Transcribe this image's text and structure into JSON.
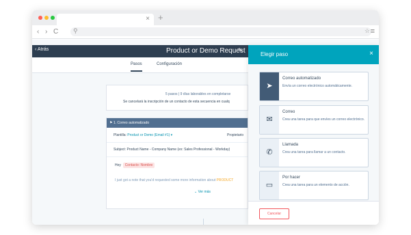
{
  "browser": {
    "tab_close": "×",
    "new_tab": "+",
    "nav_back": "‹",
    "nav_forward": "›",
    "nav_reload": "C",
    "search_glyph": "⚲",
    "star_glyph": "☆",
    "menu_glyph": "≡",
    "colors": {
      "red": "#ff5f57",
      "yellow": "#febc2e",
      "green": "#28c840"
    }
  },
  "header": {
    "back_label": "‹ Atrás",
    "title": "Product or Demo Request",
    "pencil_glyph": "✎"
  },
  "tabs": {
    "pasos": "Pasos",
    "configuracion": "Configuración"
  },
  "summary": {
    "line1": "5 pasos  |  9 días laborables en completarse",
    "line2": "Se cancelará la inscripción de un contacto de esta secuencia en cualq"
  },
  "step": {
    "header": "1. Correo automatizado",
    "flag_glyph": "⚑",
    "plantilla_label": "Plantilla:",
    "plantilla_value": "Product or Demo (Email #1) ▾",
    "propietario_label": "Propietario",
    "subject_label": "Subject:",
    "subject_value": "Product Name - Company Name (ex: Sales Professional - Workday)",
    "greeting": "Hey",
    "token": "Contacto: Nombre",
    "body": "I just got a note that you'd requested some more information about",
    "body_token": "PRODUCT",
    "ver_mas": "⌄  Ver más"
  },
  "plus_glyph": "+",
  "panel": {
    "title": "Elegir paso",
    "close_glyph": "×",
    "options": [
      {
        "title": "Correo automatizado",
        "desc": "Envía un correo electrónico automáticamente.",
        "icon": "➤"
      },
      {
        "title": "Correo",
        "desc": "Crea una tarea para que envíes un correo electrónico.",
        "icon": "✉"
      },
      {
        "title": "Llamada",
        "desc": "Crea una tarea para llamar a un contacto.",
        "icon": "✆"
      },
      {
        "title": "Por hacer",
        "desc": "Crea una tarea para un elemento de acción.",
        "icon": "▭"
      }
    ],
    "cancel": "Cancelar"
  }
}
